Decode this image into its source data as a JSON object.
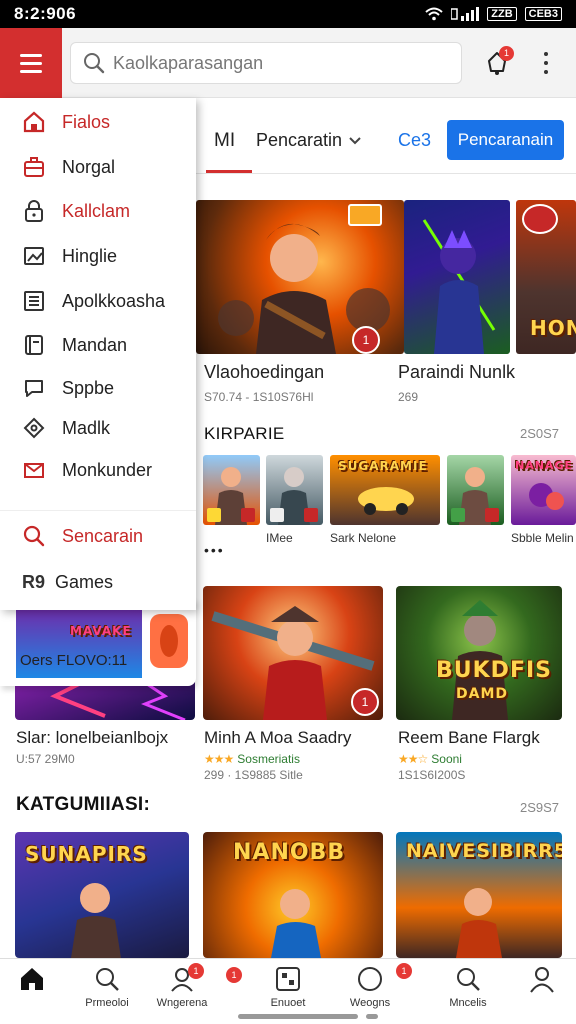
{
  "status_bar": {
    "time": "8:2:906",
    "net_label": "ZZB",
    "battery_label": "CEB3"
  },
  "search": {
    "placeholder": "Kaolkaparasangan"
  },
  "notifications": {
    "badge": "1"
  },
  "tabs": {
    "mi": "MI",
    "dropdown": "Pencaratin",
    "link": "Ce3",
    "button": "Pencaranain"
  },
  "drawer": {
    "items": [
      {
        "label": "Fialos",
        "icon": "home-icon",
        "red": true
      },
      {
        "label": "Norgal",
        "icon": "briefcase-icon",
        "red": false
      },
      {
        "label": "Kallclam",
        "icon": "lock-icon",
        "red": true
      },
      {
        "label": "Hinglie",
        "icon": "image-edit-icon",
        "red": false
      },
      {
        "label": "Apolkkoasha",
        "icon": "list-icon",
        "red": false
      },
      {
        "label": "Mandan",
        "icon": "book-icon",
        "red": false
      },
      {
        "label": "Sppbe",
        "icon": "chat-icon",
        "red": false
      },
      {
        "label": "Madlk",
        "icon": "puzzle-icon",
        "red": false
      },
      {
        "label": "Monkunder",
        "icon": "mail-icon",
        "red": false
      },
      {
        "label": "Sencarain",
        "icon": "search-icon",
        "red": true
      },
      {
        "label": "Games",
        "icon": "games-icon",
        "red": false
      }
    ],
    "games_prefix": "R9"
  },
  "featured": [
    {
      "title": "Vlaohoedingan",
      "sub": "S70.74 - 1S10S76Hl",
      "badge": "1"
    },
    {
      "title": "Paraindi Nunlk",
      "sub": "269"
    }
  ],
  "featured_third_text": "HONE",
  "section1": {
    "title": "KIRPARIE",
    "count": "2S0S7",
    "more": "•••"
  },
  "thumbs": [
    {
      "label": ""
    },
    {
      "label": "IMee"
    },
    {
      "label": "Sark Nelone",
      "banner": "SUGARAMIE"
    },
    {
      "label": ""
    },
    {
      "label": "Sbble Melin",
      "banner": "NANAGE"
    }
  ],
  "promo": {
    "text": "Oers FLOVO:11",
    "banner": "MAVAKE"
  },
  "cards_row1": [
    {
      "title": "Slar: lonelbeianlbojx",
      "rating": "",
      "sub": "U:57 29M0"
    },
    {
      "title": "Minh A Moa Saadry",
      "rating": "Sosmeriatis",
      "stars": "★★★",
      "sub": "299 · 1S9885 Sitle"
    },
    {
      "title": "Reem Bane Flargk",
      "rating": "Sooni",
      "stars": "★★☆",
      "sub": "1S1S6I200S",
      "banner": "BUKDFIS",
      "banner2": "DAMD"
    }
  ],
  "section2": {
    "title": "KATGUMIIASI:",
    "count": "2S9S7"
  },
  "cards_row2": [
    {
      "banner": "SUNAPIRS"
    },
    {
      "banner": "NANOBB"
    },
    {
      "banner": "NAIVESIBIRR5"
    }
  ],
  "bottom_nav": [
    {
      "label": "",
      "icon": "home-icon"
    },
    {
      "label": "Prmeoloi",
      "icon": "search-person-icon"
    },
    {
      "label": "Wngerena",
      "icon": "profile-icon",
      "badge": "1"
    },
    {
      "label": "Enuoet",
      "icon": "games-grid-icon",
      "badge": "1"
    },
    {
      "label": "Weogns",
      "icon": "circle-icon",
      "badge": "1"
    },
    {
      "label": "Mncelis",
      "icon": "search-icon"
    },
    {
      "label": "",
      "icon": "user-icon"
    }
  ],
  "colors": {
    "accent": "#d32f2f",
    "primary_button": "#1a73e8"
  }
}
